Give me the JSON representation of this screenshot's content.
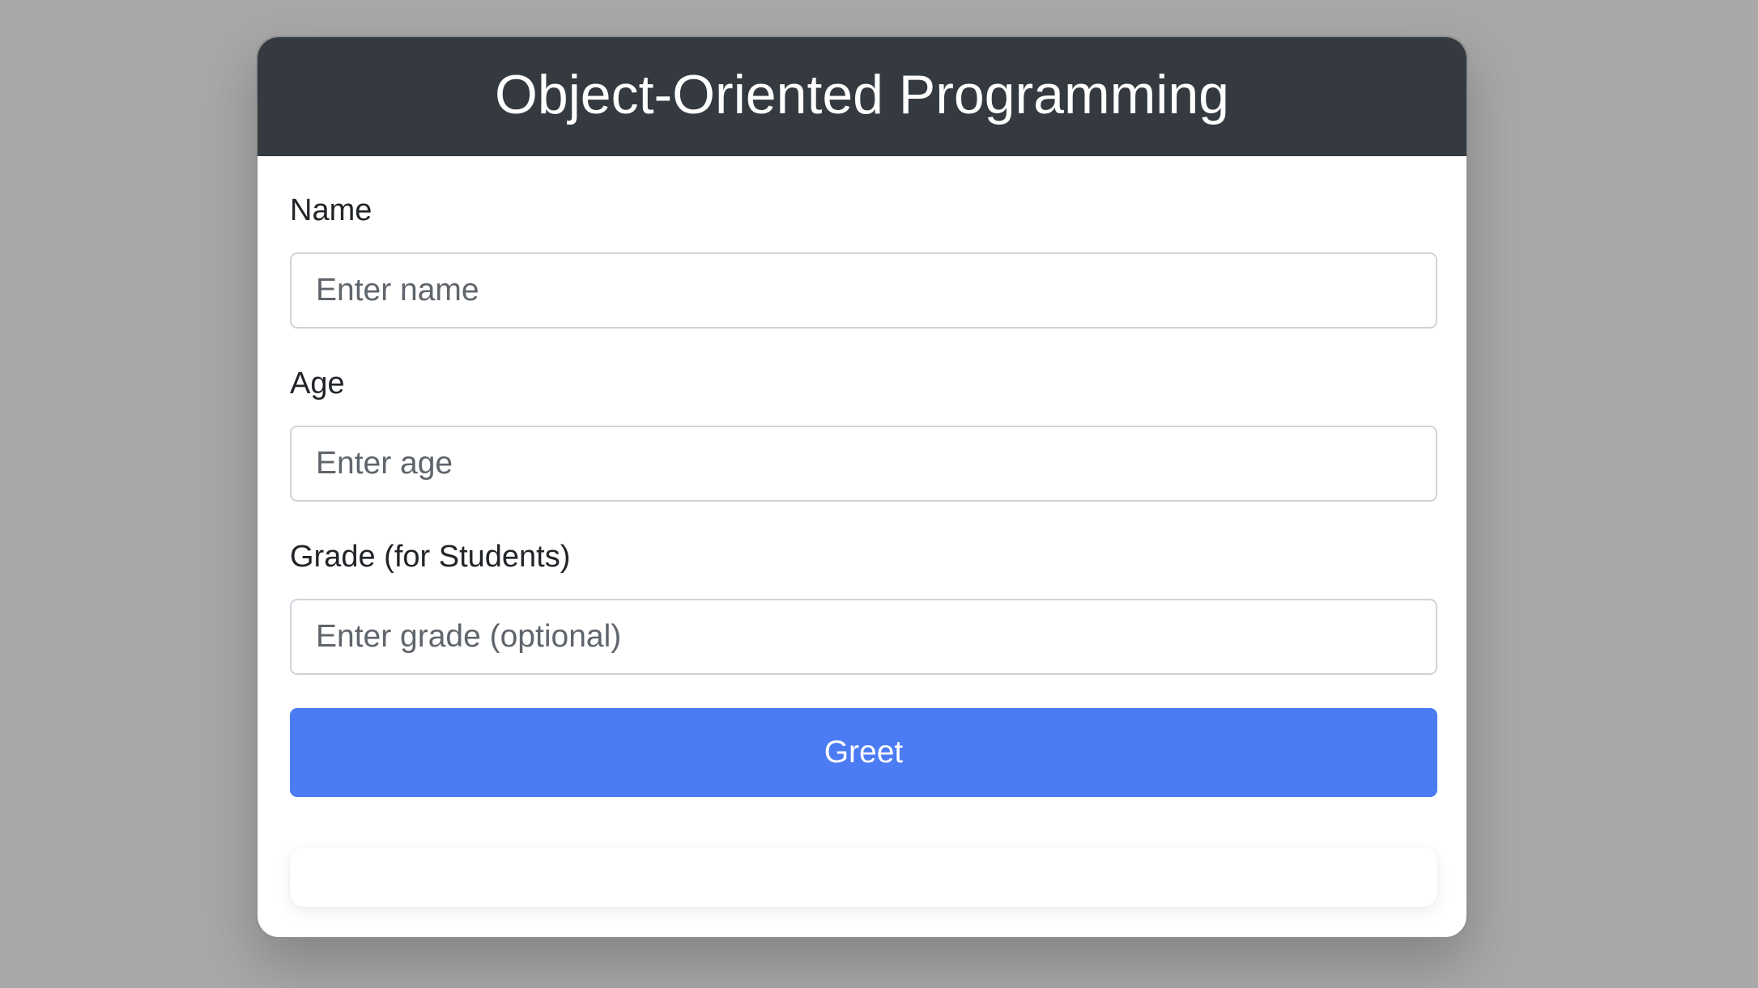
{
  "header": {
    "title": "Object-Oriented Programming"
  },
  "form": {
    "name": {
      "label": "Name",
      "value": "",
      "placeholder": "Enter name"
    },
    "age": {
      "label": "Age",
      "value": "",
      "placeholder": "Enter age"
    },
    "grade": {
      "label": "Grade (for Students)",
      "value": "",
      "placeholder": "Enter grade (optional)"
    },
    "submit_label": "Greet"
  },
  "output": {
    "text": ""
  },
  "colors": {
    "page_background": "#a8a8a8",
    "header_background": "#343a40",
    "button_background": "#4c7cf3",
    "card_background": "#ffffff"
  }
}
